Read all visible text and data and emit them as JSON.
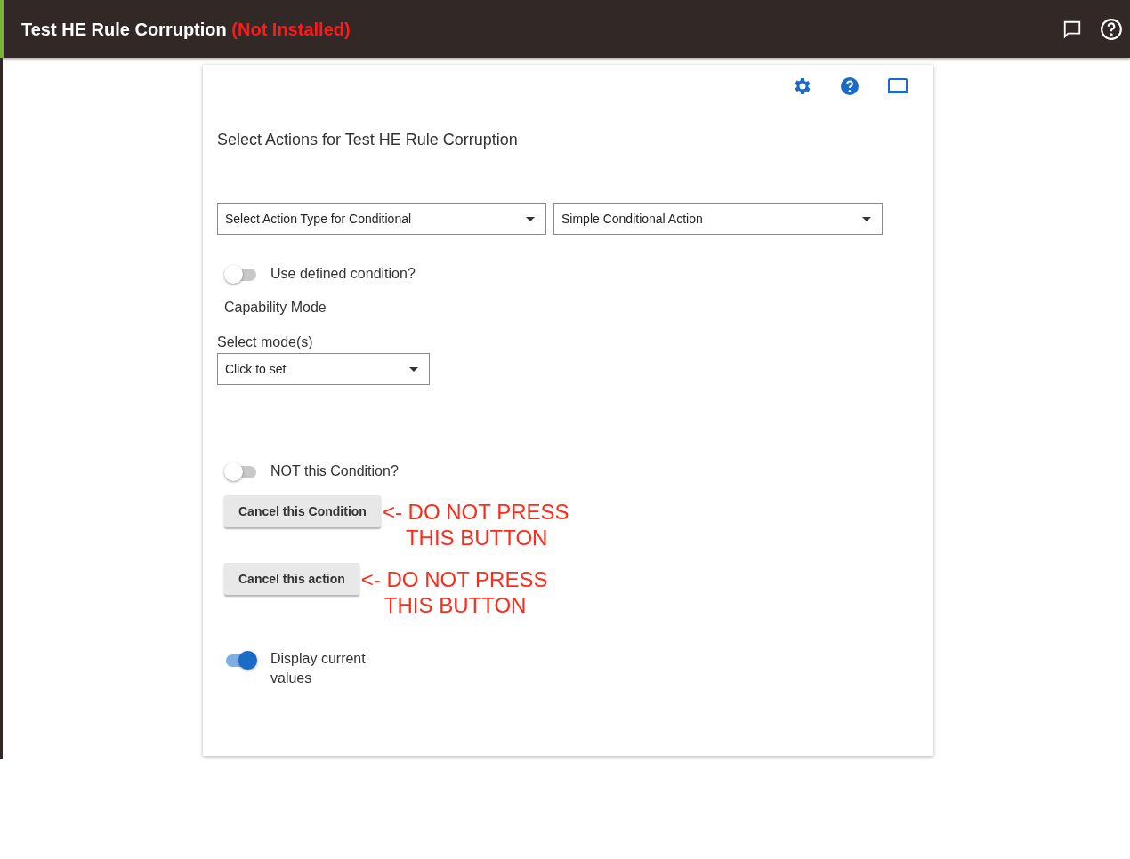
{
  "header": {
    "title": "Test HE Rule Corruption",
    "status": "(Not Installed)"
  },
  "card": {
    "heading": "Select Actions for Test HE Rule Corruption",
    "selects": [
      {
        "value": "Select Action Type for Conditional"
      },
      {
        "value": "Simple Conditional Action"
      }
    ],
    "toggle_1": {
      "label": "Use defined condition?",
      "on": false
    },
    "capability": "Capability Mode",
    "mode_select": {
      "label": "Select mode(s)",
      "value": "Click to set"
    },
    "toggle_2": {
      "label": "NOT this Condition?",
      "on": false
    },
    "buttons": [
      {
        "label": "Cancel this Condition",
        "note": [
          "<- DO NOT PRESS",
          "THIS BUTTON"
        ]
      },
      {
        "label": "Cancel this action",
        "note": [
          "<- DO NOT PRESS",
          "THIS BUTTON"
        ]
      }
    ],
    "toggle_3": {
      "label": "Display current values",
      "on": true
    }
  }
}
